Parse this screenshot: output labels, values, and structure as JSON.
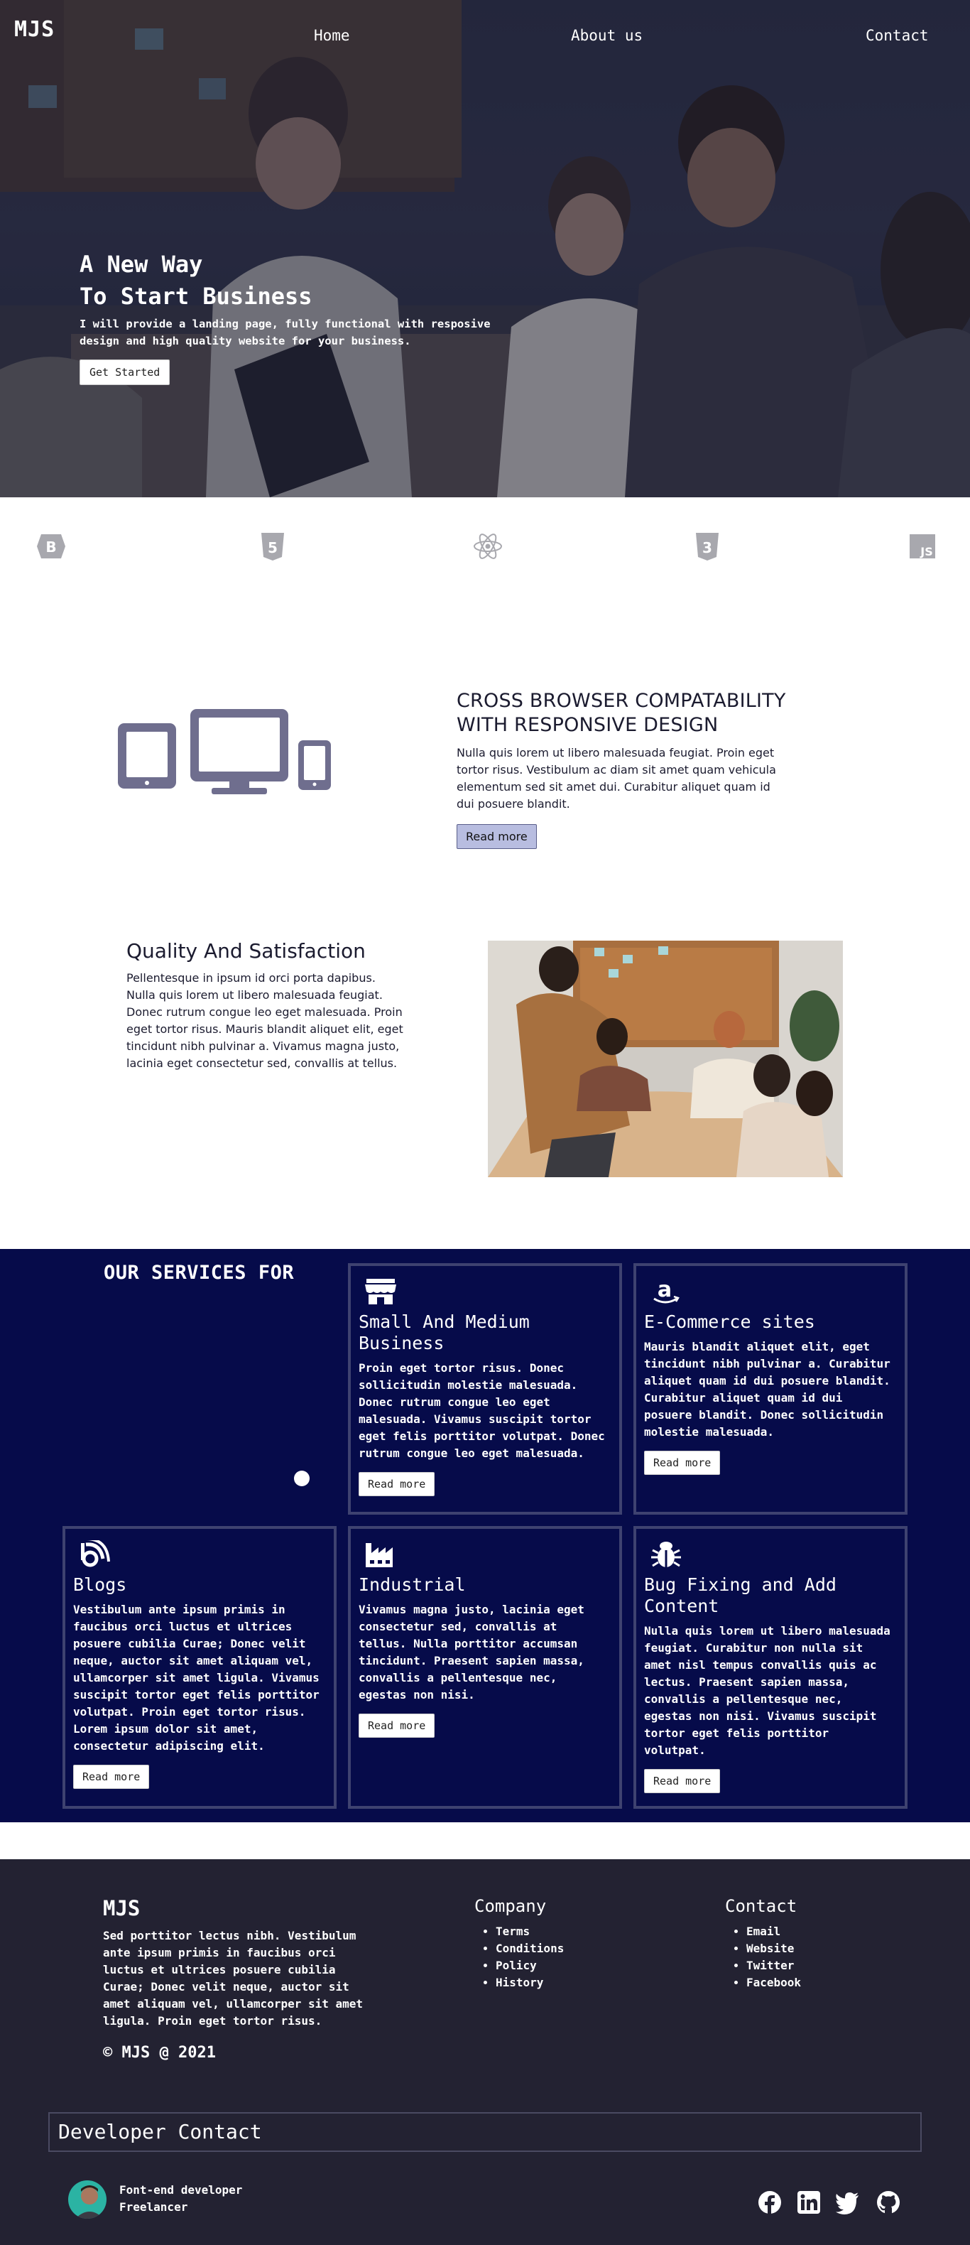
{
  "brand": {
    "logo": "MJS"
  },
  "nav": {
    "home": "Home",
    "about": "About us",
    "contact": "Contact"
  },
  "hero": {
    "title_line1": "A New Way",
    "title_line2": "To Start Business",
    "subtitle": "I will provide a landing page, fully functional with resposive design and high quality website for your business.",
    "cta": "Get Started"
  },
  "tech_icons": [
    "bootstrap-icon",
    "html5-icon",
    "react-icon",
    "css3-icon",
    "javascript-icon"
  ],
  "feature_responsive": {
    "title": "CROSS BROWSER COMPATABILITY WITH RESPONSIVE DESIGN",
    "text": "Nulla quis lorem ut libero malesuada feugiat. Proin eget tortor risus. Vestibulum ac diam sit amet quam vehicula elementum sed sit amet dui. Curabitur aliquet quam id dui posuere blandit.",
    "button": "Read more"
  },
  "feature_quality": {
    "title": "Quality And Satisfaction",
    "text": "Pellentesque in ipsum id orci porta dapibus. Nulla quis lorem ut libero malesuada feugiat. Donec rutrum congue leo eget malesuada. Proin eget tortor risus. Mauris blandit aliquet elit, eget tincidunt nibh pulvinar a. Vivamus magna justo, lacinia eget consectetur sed, convallis at tellus."
  },
  "services": {
    "heading": "OUR SERVICES FOR",
    "cards": [
      {
        "icon": "store-icon",
        "title": "Small And Medium Business",
        "text": "Proin eget tortor risus. Donec sollicitudin molestie malesuada. Donec rutrum congue leo eget malesuada. Vivamus suscipit tortor eget felis porttitor volutpat. Donec rutrum congue leo eget malesuada.",
        "button": "Read more"
      },
      {
        "icon": "amazon-icon",
        "title": "E-Commerce sites",
        "text": "Mauris blandit aliquet elit, eget tincidunt nibh pulvinar a. Curabitur aliquet quam id dui posuere blandit. Curabitur aliquet quam id dui posuere blandit. Donec sollicitudin molestie malesuada.",
        "button": "Read more"
      },
      {
        "icon": "blog-icon",
        "title": "Blogs",
        "text": "Vestibulum ante ipsum primis in faucibus orci luctus et ultrices posuere cubilia Curae; Donec velit neque, auctor sit amet aliquam vel, ullamcorper sit amet ligula. Vivamus suscipit tortor eget felis porttitor volutpat. Proin eget tortor risus. Lorem ipsum dolor sit amet, consectetur adipiscing elit.",
        "button": "Read more"
      },
      {
        "icon": "industry-icon",
        "title": "Industrial",
        "text": "Vivamus magna justo, lacinia eget consectetur sed, convallis at tellus. Nulla porttitor accumsan tincidunt. Praesent sapien massa, convallis a pellentesque nec, egestas non nisi.",
        "button": "Read more"
      },
      {
        "icon": "bug-icon",
        "title": "Bug Fixing and Add Content",
        "text": "Nulla quis lorem ut libero malesuada feugiat. Curabitur non nulla sit amet nisl tempus convallis quis ac lectus. Praesent sapien massa, convallis a pellentesque nec, egestas non nisi. Vivamus suscipit tortor eget felis porttitor volutpat.",
        "button": "Read more"
      }
    ]
  },
  "footer": {
    "brand": "MJS",
    "about": "Sed porttitor lectus nibh. Vestibulum ante ipsum primis in faucibus orci luctus et ultrices posuere cubilia Curae; Donec velit neque, auctor sit amet aliquam vel, ullamcorper sit amet ligula. Proin eget tortor risus.",
    "copyright": "© MJS @ 2021",
    "company": {
      "heading": "Company",
      "links": [
        "Terms",
        "Conditions",
        "Policy",
        "History"
      ]
    },
    "contact": {
      "heading": "Contact",
      "links": [
        "Email",
        "Website",
        "Twitter",
        "Facebook"
      ]
    },
    "developer": {
      "heading": "Developer Contact",
      "role": "Font-end developer",
      "status": "Freelancer"
    },
    "social_icons": [
      "facebook-icon",
      "linkedin-icon",
      "twitter-icon",
      "github-icon"
    ]
  },
  "colors": {
    "services_bg": "#060b4a",
    "footer_bg": "#232232",
    "button_lavender": "#b8bde0",
    "icon_slate": "#6f6e8e"
  }
}
